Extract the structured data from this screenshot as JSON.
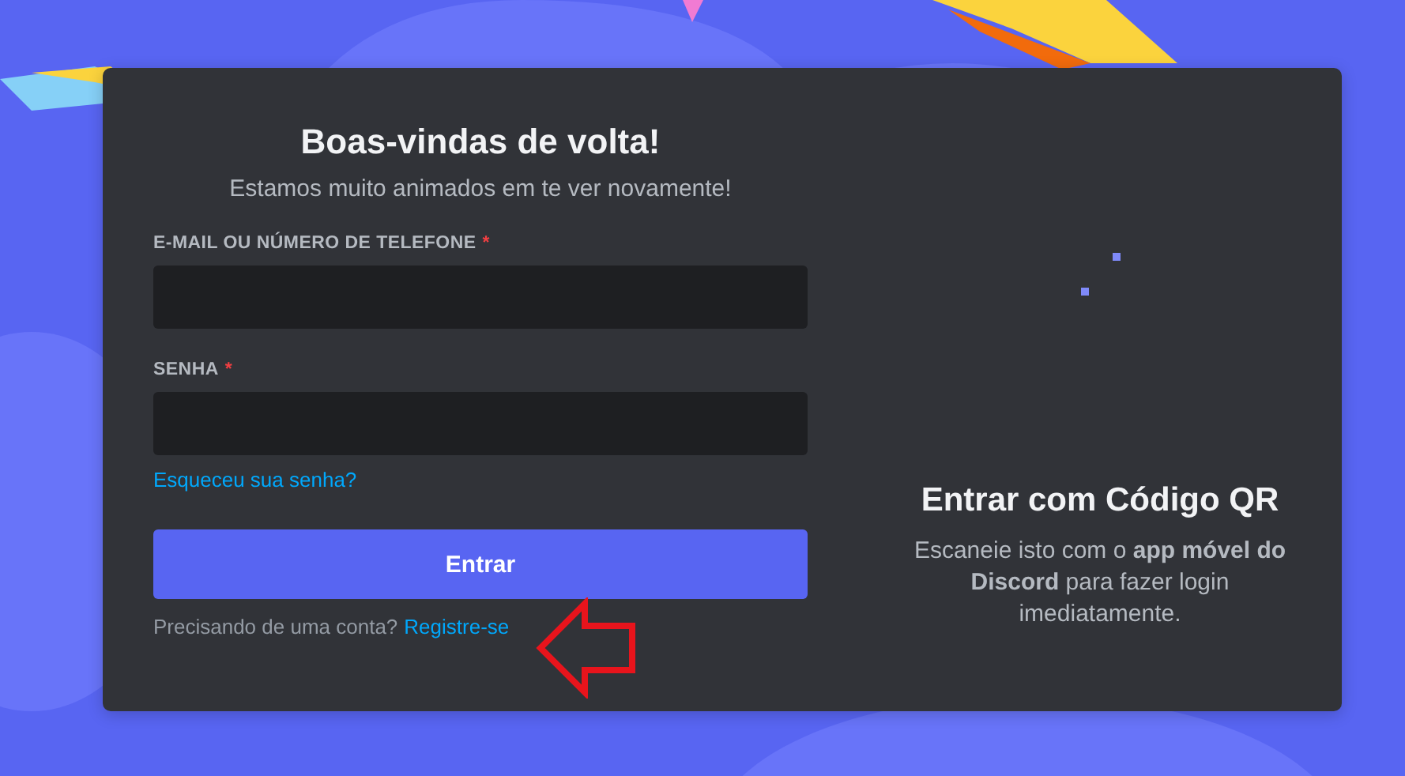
{
  "login": {
    "title": "Boas-vindas de volta!",
    "subtitle": "Estamos muito animados em te ver novamente!",
    "fields": [
      {
        "label": "E-MAIL OU NÚMERO DE TELEFONE",
        "required_mark": "*"
      },
      {
        "label": "SENHA",
        "required_mark": "*"
      }
    ],
    "forgot_link": "Esqueceu sua senha?",
    "submit_button": "Entrar",
    "register_prompt": "Precisando de uma conta?",
    "register_link": "Registre-se"
  },
  "qr": {
    "title": "Entrar com Código QR",
    "description": "Escaneie isto com o **app móvel do Discord** para fazer login imediatamente."
  }
}
